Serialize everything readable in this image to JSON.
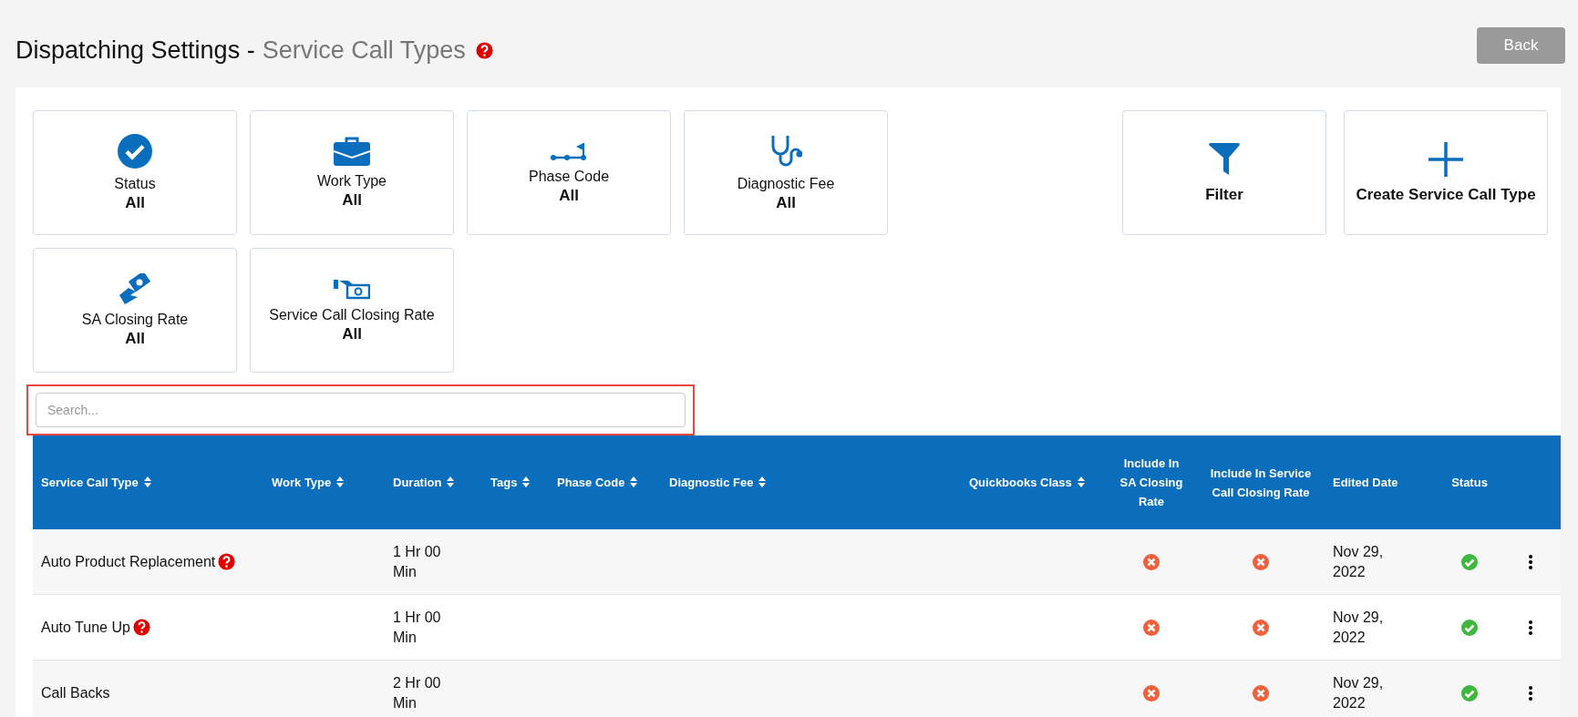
{
  "header": {
    "title": "Dispatching Settings",
    "separator": "-",
    "subtitle": "Service Call Types",
    "back_button": "Back"
  },
  "filter_cards": [
    {
      "kind": "status",
      "label": "Status",
      "value": "All"
    },
    {
      "kind": "work-type",
      "label": "Work Type",
      "value": "All"
    },
    {
      "kind": "phase-code",
      "label": "Phase Code",
      "value": "All"
    },
    {
      "kind": "diagnostic-fee",
      "label": "Diagnostic Fee",
      "value": "All"
    },
    {
      "kind": "sa-closing",
      "label": "SA Closing Rate",
      "value": "All"
    },
    {
      "kind": "sc-closing",
      "label": "Service Call Closing Rate",
      "value": "All"
    }
  ],
  "action_cards": [
    {
      "kind": "filter",
      "label": "Filter"
    },
    {
      "kind": "create",
      "label": "Create Service Call Type"
    }
  ],
  "search": {
    "placeholder": "Search...",
    "highlighted": true
  },
  "table": {
    "columns": [
      {
        "label": "Service Call Type",
        "sortable": true
      },
      {
        "label": "Work Type",
        "sortable": true
      },
      {
        "label": "Duration",
        "sortable": true
      },
      {
        "label": "Tags",
        "sortable": true
      },
      {
        "label": "Phase Code",
        "sortable": true
      },
      {
        "label": "Diagnostic Fee",
        "sortable": true
      },
      {
        "label": "Quickbooks Class",
        "sortable": true
      },
      {
        "label": "Include In SA Closing Rate",
        "sortable": false
      },
      {
        "label": "Include In Service Call Closing Rate",
        "sortable": false
      },
      {
        "label": "Edited Date",
        "sortable": false
      },
      {
        "label": "Status",
        "sortable": false
      }
    ],
    "rows": [
      {
        "name": "Auto Product Replacement",
        "help": true,
        "duration": "1 Hr 00 Min",
        "include_sa": false,
        "include_service_call": false,
        "edited_date": "Nov 29, 2022",
        "active": true
      },
      {
        "name": "Auto Tune Up",
        "help": true,
        "duration": "1 Hr 00 Min",
        "include_sa": false,
        "include_service_call": false,
        "edited_date": "Nov 29, 2022",
        "active": true
      },
      {
        "name": "Call Backs",
        "help": false,
        "duration": "2 Hr 00 Min",
        "include_sa": false,
        "include_service_call": false,
        "edited_date": "Nov 29, 2022",
        "active": true
      }
    ]
  }
}
